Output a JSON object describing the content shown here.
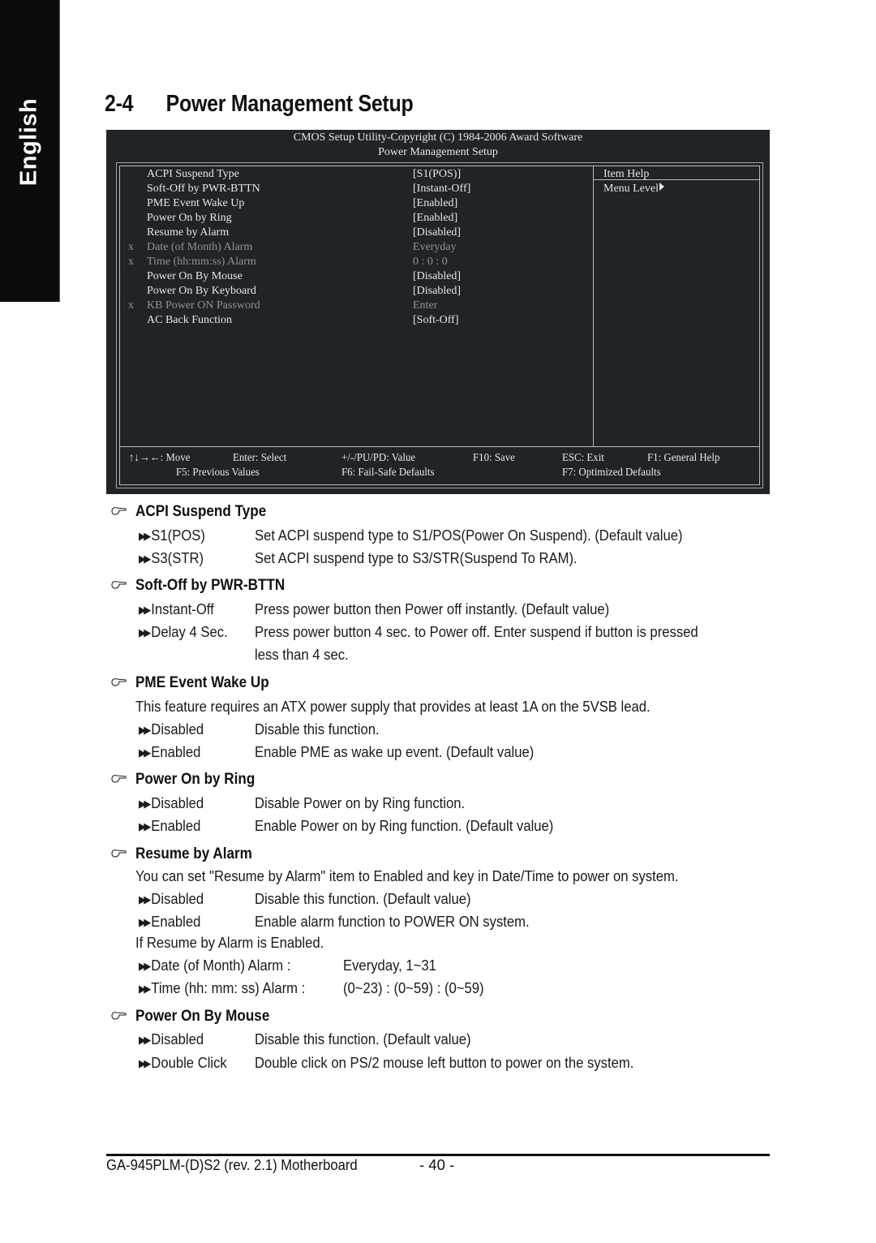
{
  "side_tab": {
    "label": "English"
  },
  "title": {
    "number": "2-4",
    "text": "Power Management Setup"
  },
  "bios": {
    "header_line1": "CMOS Setup Utility-Copyright (C) 1984-2006 Award Software",
    "header_line2": "Power Management Setup",
    "items": [
      {
        "mark": "",
        "label": "ACPI Suspend Type",
        "value": "[S1(POS)]",
        "disabled": false
      },
      {
        "mark": "",
        "label": "Soft-Off by PWR-BTTN",
        "value": "[Instant-Off]",
        "disabled": false
      },
      {
        "mark": "",
        "label": "PME Event Wake Up",
        "value": "[Enabled]",
        "disabled": false
      },
      {
        "mark": "",
        "label": "Power On by Ring",
        "value": "[Enabled]",
        "disabled": false
      },
      {
        "mark": "",
        "label": "Resume by Alarm",
        "value": "[Disabled]",
        "disabled": false
      },
      {
        "mark": "x",
        "label": "Date (of Month) Alarm",
        "value": "Everyday",
        "disabled": true
      },
      {
        "mark": "x",
        "label": "Time (hh:mm:ss) Alarm",
        "value": "0 : 0 : 0",
        "disabled": true
      },
      {
        "mark": "",
        "label": "Power On By Mouse",
        "value": "[Disabled]",
        "disabled": false
      },
      {
        "mark": "",
        "label": "Power On By Keyboard",
        "value": "[Disabled]",
        "disabled": false
      },
      {
        "mark": "x",
        "label": "KB Power ON Password",
        "value": "Enter",
        "disabled": true
      },
      {
        "mark": "",
        "label": "AC Back Function",
        "value": "[Soft-Off]",
        "disabled": false
      }
    ],
    "help_title": "Item Help",
    "help_menu_level": "Menu Level",
    "footer": {
      "move": "↑↓→←: Move",
      "enter": "Enter: Select",
      "value": "+/-/PU/PD: Value",
      "save": "F10: Save",
      "exit": "ESC: Exit",
      "help": "F1: General Help",
      "prev": "F5: Previous Values",
      "failsafe": "F6: Fail-Safe Defaults",
      "optimized": "F7: Optimized Defaults"
    }
  },
  "sections": {
    "acpi": {
      "title": "ACPI Suspend Type",
      "options": [
        {
          "name": "S1(POS)",
          "desc": "Set ACPI suspend type to S1/POS(Power On Suspend). (Default value)"
        },
        {
          "name": "S3(STR)",
          "desc": "Set ACPI suspend type to S3/STR(Suspend To RAM)."
        }
      ]
    },
    "softoff": {
      "title": "Soft-Off by PWR-BTTN",
      "options": [
        {
          "name": "Instant-Off",
          "desc": "Press power button then Power off instantly. (Default value)"
        },
        {
          "name": "Delay 4 Sec.",
          "desc": "Press power button 4 sec. to Power off. Enter suspend if button is pressed",
          "desc2": "less than 4 sec."
        }
      ]
    },
    "pme": {
      "title": "PME Event Wake Up",
      "intro": "This feature requires an ATX power supply that provides at least 1A on the 5VSB lead.",
      "options": [
        {
          "name": "Disabled",
          "desc": "Disable this function."
        },
        {
          "name": "Enabled",
          "desc": "Enable PME as wake up event. (Default value)"
        }
      ]
    },
    "ring": {
      "title": "Power On by Ring",
      "options": [
        {
          "name": "Disabled",
          "desc": "Disable Power on by Ring function."
        },
        {
          "name": "Enabled",
          "desc": "Enable Power on by Ring function. (Default value)"
        }
      ]
    },
    "alarm": {
      "title": "Resume by Alarm",
      "intro": "You can set \"Resume by Alarm\" item to Enabled and key in Date/Time to power on system.",
      "options": [
        {
          "name": "Disabled",
          "desc": "Disable this function. (Default value)"
        },
        {
          "name": "Enabled",
          "desc": "Enable alarm function to POWER ON system."
        }
      ],
      "note": "If Resume by Alarm is Enabled.",
      "sub": [
        {
          "name": "Date (of Month) Alarm :",
          "desc": "Everyday, 1~31"
        },
        {
          "name": "Time (hh: mm: ss) Alarm :",
          "desc": "(0~23) : (0~59) : (0~59)"
        }
      ]
    },
    "mouse": {
      "title": "Power On By Mouse",
      "options": [
        {
          "name": "Disabled",
          "desc": "Disable this function. (Default value)"
        },
        {
          "name": "Double Click",
          "desc": "Double click on PS/2 mouse left button to power on the system."
        }
      ]
    }
  },
  "footer": {
    "model": "GA-945PLM-(D)S2 (rev. 2.1) Motherboard",
    "page": "- 40 -"
  }
}
